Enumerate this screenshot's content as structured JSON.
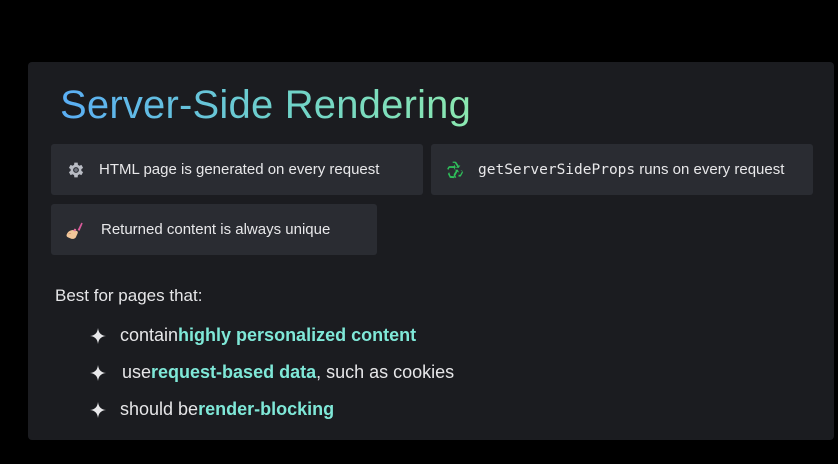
{
  "slide": {
    "title": "Server-Side Rendering",
    "cards": [
      {
        "icon": "gear-icon",
        "text": "HTML page is generated on every request"
      },
      {
        "icon": "recycle-icon",
        "code": "getServerSideProps",
        "text": " runs on every request"
      },
      {
        "icon": "nail-polish-icon",
        "text": "Returned content is always unique"
      }
    ],
    "best_for_label": "Best for pages that:",
    "bullets": [
      {
        "icon": "sparkle-icon",
        "pre": "contain ",
        "highlight": "highly personalized content",
        "post": ""
      },
      {
        "icon": "sparkle-icon",
        "pre": "use ",
        "highlight": "request-based data",
        "post": ", such as cookies"
      },
      {
        "icon": "sparkle-icon",
        "pre": "should be ",
        "highlight": "render-blocking",
        "post": ""
      }
    ],
    "colors": {
      "background": "#000000",
      "panel": "#1b1c20",
      "card": "#2a2c32",
      "highlight": "#7fe8d8",
      "title_gradient_start": "#5aaef5",
      "title_gradient_end": "#8be8b0"
    }
  }
}
